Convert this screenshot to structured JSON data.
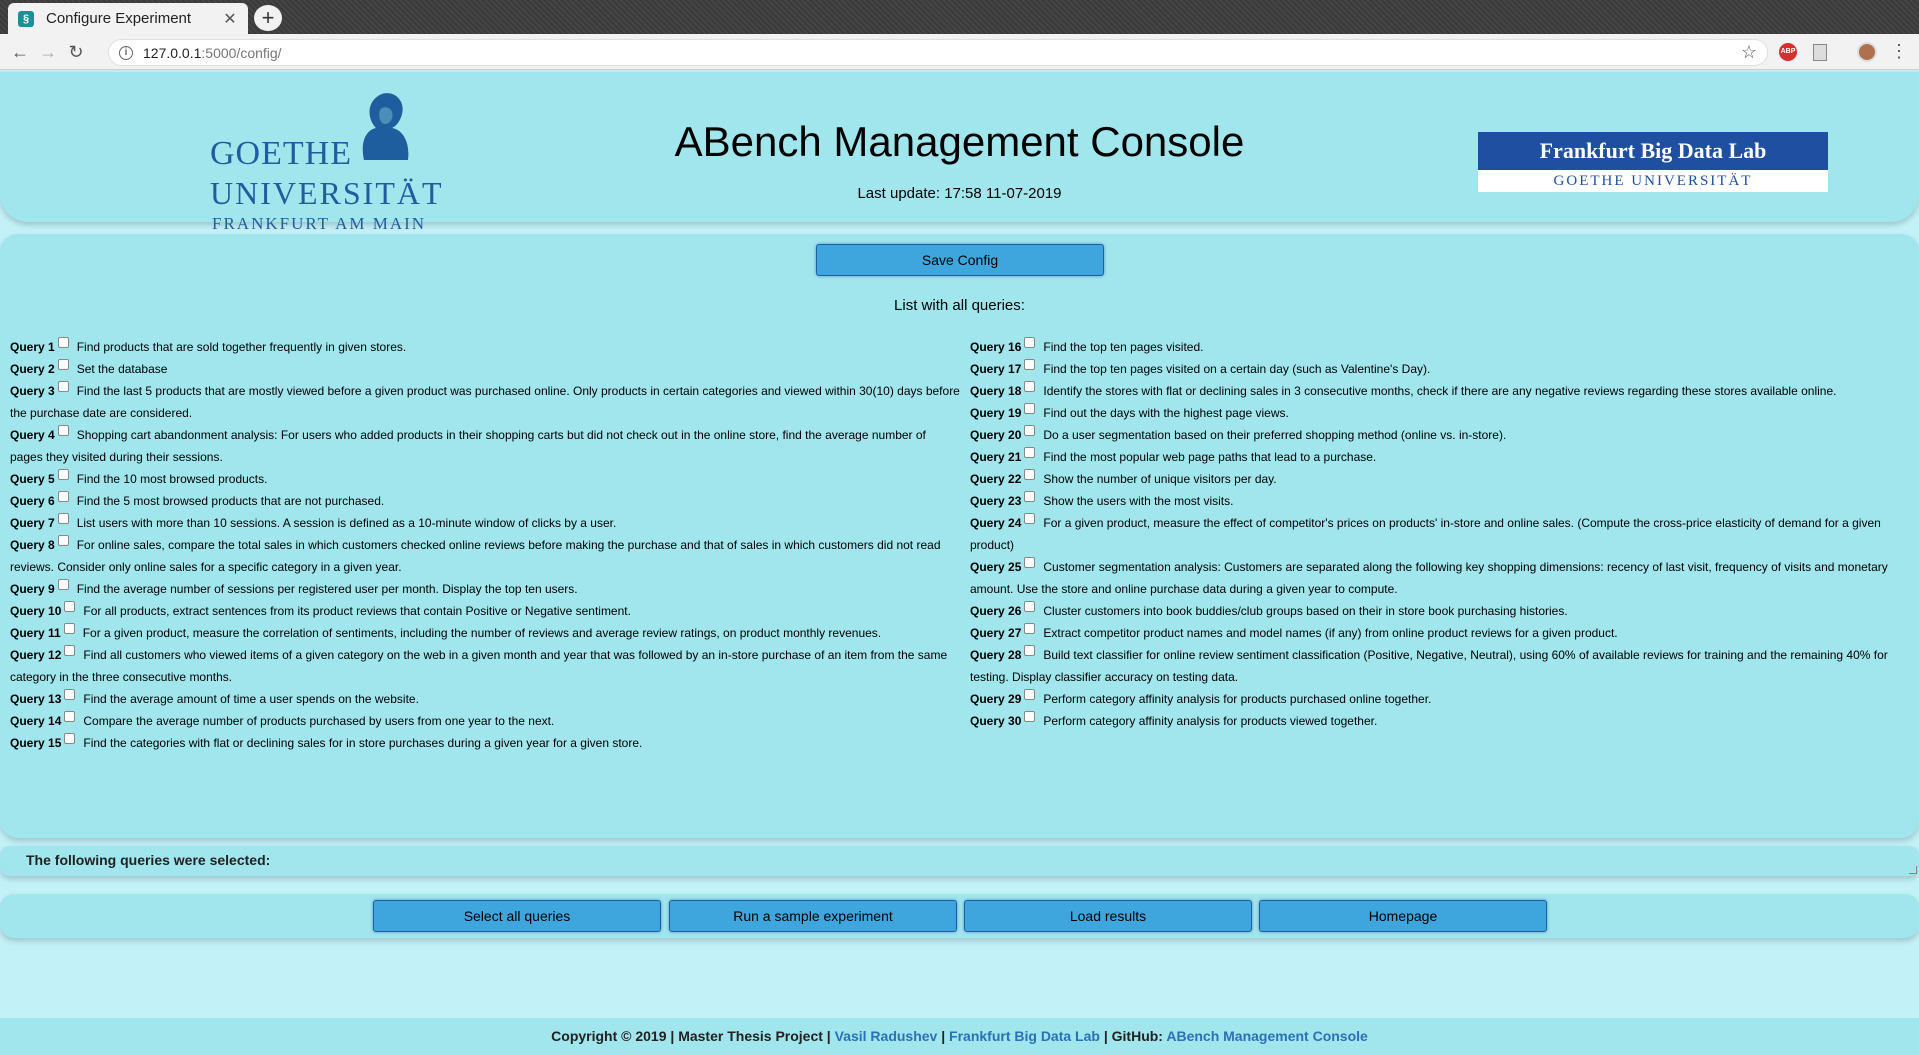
{
  "browser": {
    "tab_title": "Configure Experiment",
    "url_host": "127.0.0.1",
    "url_rest": ":5000/config/",
    "extension_abp": "ABP"
  },
  "header": {
    "goethe_line1": "GOETHE",
    "goethe_line2": "UNIVERSITÄT",
    "goethe_line3": "FRANKFURT AM MAIN",
    "title": "ABench Management Console",
    "last_update": "Last update: 17:58 11-07-2019",
    "fbdl_top": "Frankfurt Big Data Lab",
    "fbdl_bottom": "GOETHE UNIVERSITÄT"
  },
  "main": {
    "save_label": "Save Config",
    "list_title": "List with all queries:",
    "queries_left": [
      {
        "label": "Query 1",
        "text": "Find products that are sold together frequently in given stores."
      },
      {
        "label": "Query 2",
        "text": "Set the database"
      },
      {
        "label": "Query 3",
        "text": "Find the last 5 products that are mostly viewed before a given product was purchased online. Only products in certain categories and viewed within 30(10) days before the purchase date are considered."
      },
      {
        "label": "Query 4",
        "text": "Shopping cart abandonment analysis: For users who added products in their shopping carts but did not check out in the online store, find the average number of pages they visited during their sessions."
      },
      {
        "label": "Query 5",
        "text": "Find the 10 most browsed products."
      },
      {
        "label": "Query 6",
        "text": "Find the 5 most browsed products that are not purchased."
      },
      {
        "label": "Query 7",
        "text": "List users with more than 10 sessions. A session is defined as a 10-minute window of clicks by a user."
      },
      {
        "label": "Query 8",
        "text": "For online sales, compare the total sales in which customers checked online reviews before making the purchase and that of sales in which customers did not read reviews. Consider only online sales for a specific category in a given year."
      },
      {
        "label": "Query 9",
        "text": "Find the average number of sessions per registered user per month. Display the top ten users."
      },
      {
        "label": "Query 10",
        "text": "For all products, extract sentences from its product reviews that contain Positive or Negative sentiment."
      },
      {
        "label": "Query 11",
        "text": "For a given product, measure the correlation of sentiments, including the number of reviews and average review ratings, on product monthly revenues."
      },
      {
        "label": "Query 12",
        "text": "Find all customers who viewed items of a given category on the web in a given month and year that was followed by an in-store purchase of an item from the same category in the three consecutive months."
      },
      {
        "label": "Query 13",
        "text": "Find the average amount of time a user spends on the website."
      },
      {
        "label": "Query 14",
        "text": "Compare the average number of products purchased by users from one year to the next."
      },
      {
        "label": "Query 15",
        "text": "Find the categories with flat or declining sales for in store purchases during a given year for a given store."
      }
    ],
    "queries_right": [
      {
        "label": "Query 16",
        "text": "Find the top ten pages visited."
      },
      {
        "label": "Query 17",
        "text": "Find the top ten pages visited on a certain day (such as Valentine's Day)."
      },
      {
        "label": "Query 18",
        "text": "Identify the stores with flat or declining sales in 3 consecutive months, check if there are any negative reviews regarding these stores available online."
      },
      {
        "label": "Query 19",
        "text": "Find out the days with the highest page views."
      },
      {
        "label": "Query 20",
        "text": "Do a user segmentation based on their preferred shopping method (online vs. in-store)."
      },
      {
        "label": "Query 21",
        "text": "Find the most popular web page paths that lead to a purchase."
      },
      {
        "label": "Query 22",
        "text": "Show the number of unique visitors per day."
      },
      {
        "label": "Query 23",
        "text": "Show the users with the most visits."
      },
      {
        "label": "Query 24",
        "text": "For a given product, measure the effect of competitor's prices on products' in-store and online sales. (Compute the cross-price elasticity of demand for a given product)"
      },
      {
        "label": "Query 25",
        "text": "Customer segmentation analysis: Customers are separated along the following key shopping dimensions: recency of last visit, frequency of visits and monetary amount. Use the store and online purchase data during a given year to compute."
      },
      {
        "label": "Query 26",
        "text": "Cluster customers into book buddies/club groups based on their in store book purchasing histories."
      },
      {
        "label": "Query 27",
        "text": "Extract competitor product names and model names (if any) from online product reviews for a given product."
      },
      {
        "label": "Query 28",
        "text": "Build text classifier for online review sentiment classification (Positive, Negative, Neutral), using 60% of available reviews for training and the remaining 40% for testing. Display classifier accuracy on testing data."
      },
      {
        "label": "Query 29",
        "text": "Perform category affinity analysis for products purchased online together."
      },
      {
        "label": "Query 30",
        "text": "Perform category affinity analysis for products viewed together."
      }
    ]
  },
  "selected": {
    "label": "The following queries were selected:"
  },
  "actions": {
    "select_all": "Select all queries",
    "run_sample": "Run a sample experiment",
    "load_results": "Load results",
    "homepage": "Homepage"
  },
  "footer": {
    "prefix": "Copyright © 2019 | Master Thesis Project | ",
    "author": "Vasil Radushev",
    "sep1": " | ",
    "lab": "Frankfurt Big Data Lab",
    "sep2": " | GitHub: ",
    "repo": "ABench Management Console"
  }
}
